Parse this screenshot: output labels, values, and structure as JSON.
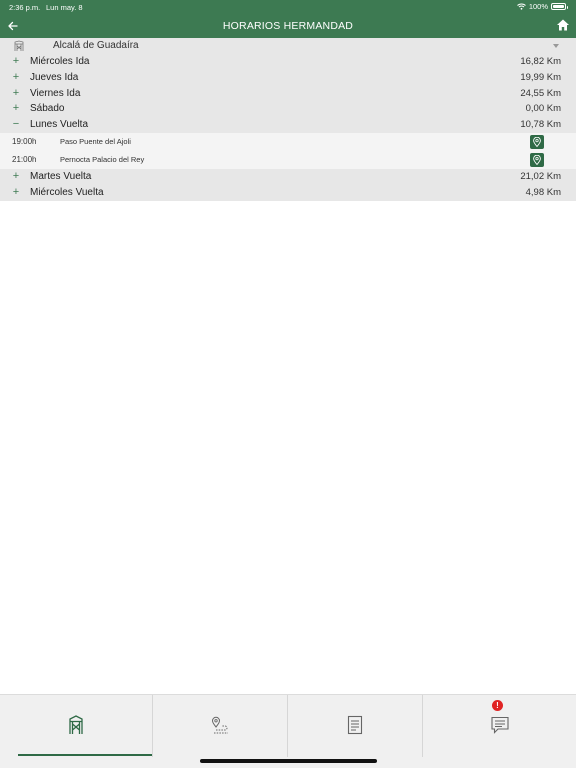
{
  "status_bar": {
    "time": "2:36 p.m.",
    "date": "Lun may. 8",
    "battery": "100%"
  },
  "header": {
    "title": "HORARIOS HERMANDAD",
    "back_icon": "back-arrow-icon",
    "home_icon": "home-icon",
    "color": "#3d7a52"
  },
  "selector": {
    "value": "Alcalá de Guadaíra",
    "icon": "hermandad-icon"
  },
  "days": [
    {
      "sign": "+",
      "label": "Miércoles Ida",
      "km": "16,82 Km"
    },
    {
      "sign": "+",
      "label": "Jueves Ida",
      "km": "19,99 Km"
    },
    {
      "sign": "+",
      "label": "Viernes Ida",
      "km": "24,55 Km"
    },
    {
      "sign": "+",
      "label": "Sábado",
      "km": "0,00 Km"
    },
    {
      "sign": "−",
      "label": "Lunes Vuelta",
      "km": "10,78 Km",
      "entries": [
        {
          "hour": "19:00h",
          "place": "Paso Puente del Ajoli"
        },
        {
          "hour": "21:00h",
          "place": "Pernocta Palacio del Rey"
        }
      ]
    },
    {
      "sign": "+",
      "label": "Martes Vuelta",
      "km": "21,02 Km"
    },
    {
      "sign": "+",
      "label": "Miércoles Vuelta",
      "km": "4,98 Km"
    }
  ],
  "tabbar": {
    "tabs": [
      "hermandad-icon",
      "route-map-icon",
      "document-icon",
      "chat-icon"
    ],
    "badge": "!",
    "active_color": "#2f6a46",
    "badge_color": "#e02424"
  }
}
